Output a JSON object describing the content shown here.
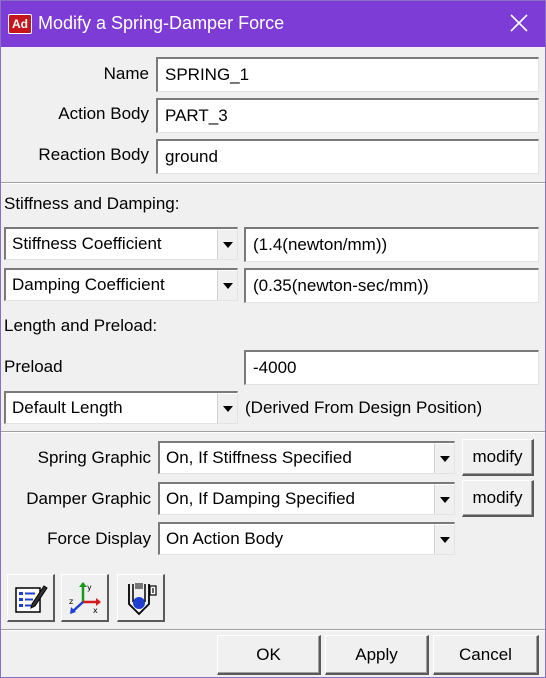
{
  "window": {
    "app_badge": "Ad",
    "title": "Modify a Spring-Damper Force",
    "close_icon": "close-icon"
  },
  "general": {
    "name_label": "Name",
    "name_value": "SPRING_1",
    "action_body_label": "Action Body",
    "action_body_value": "PART_3",
    "reaction_body_label": "Reaction Body",
    "reaction_body_value": "ground"
  },
  "stiffness_damping": {
    "heading": "Stiffness and Damping:",
    "stiffness_select": "Stiffness Coefficient",
    "stiffness_value": "(1.4(newton/mm))",
    "damping_select": "Damping Coefficient",
    "damping_value": "(0.35(newton-sec/mm))"
  },
  "length_preload": {
    "heading": "Length and Preload:",
    "preload_label": "Preload",
    "preload_value": "-4000",
    "length_select": "Default Length",
    "length_note": "(Derived From Design Position)"
  },
  "graphics": {
    "spring_graphic_label": "Spring Graphic",
    "spring_graphic_value": "On, If Stiffness Specified",
    "spring_modify": "modify",
    "damper_graphic_label": "Damper Graphic",
    "damper_graphic_value": "On, If Damping Specified",
    "damper_modify": "modify",
    "force_display_label": "Force Display",
    "force_display_value": "On Action Body"
  },
  "toolbar": {
    "icons": [
      "edit-form-icon",
      "coordinate-axes-icon",
      "function-builder-icon"
    ]
  },
  "buttons": {
    "ok": "OK",
    "apply": "Apply",
    "cancel": "Cancel"
  },
  "colors": {
    "titlebar": "#7d3cd6",
    "app_badge": "#c4161c"
  }
}
